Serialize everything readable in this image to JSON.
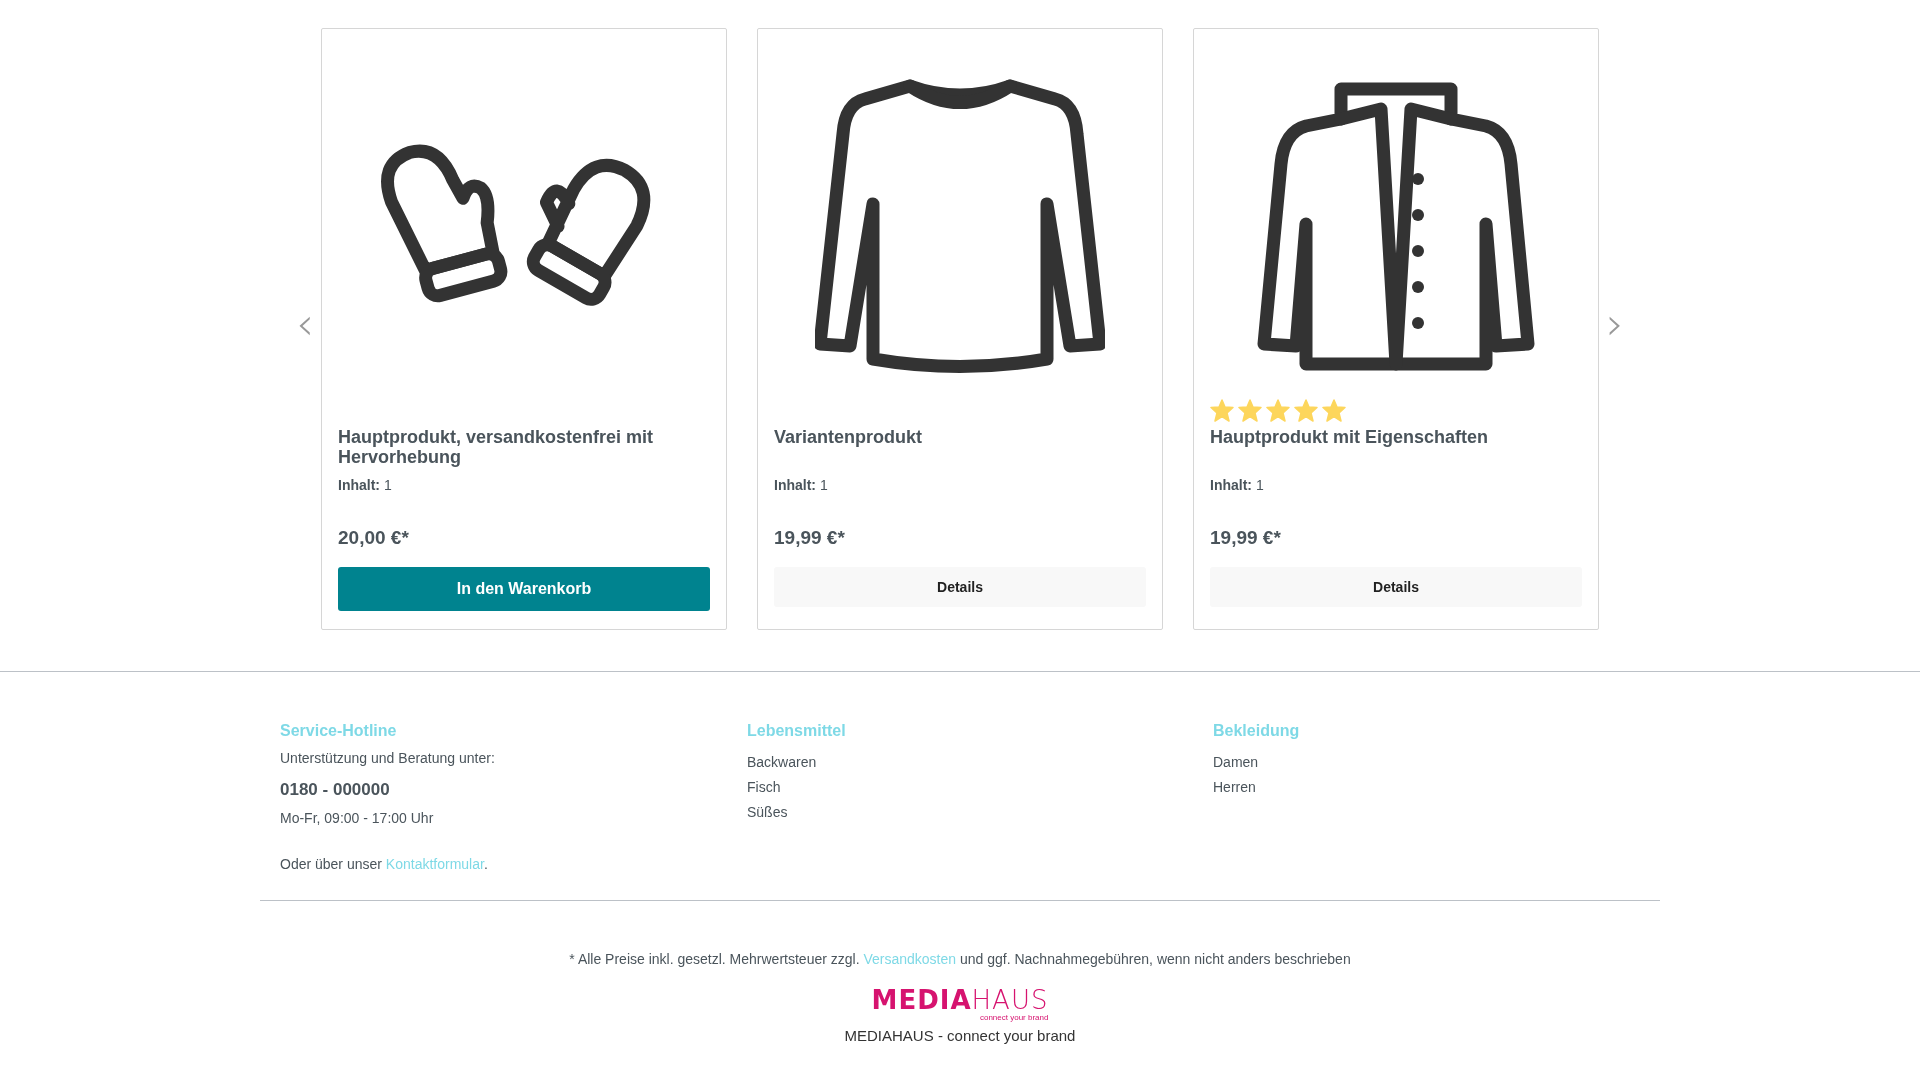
{
  "slider": {
    "prev": "‹",
    "next": "›"
  },
  "products": [
    {
      "title": "Hauptprodukt, versandkostenfrei mit Hervorhebung",
      "content_label": "Inhalt:",
      "content_value": "1",
      "price": "20,00 €*",
      "button": {
        "kind": "primary",
        "label": "In den Warenkorb"
      }
    },
    {
      "title": "Variantenprodukt",
      "content_label": "Inhalt:",
      "content_value": "1",
      "price": "19,99 €*",
      "button": {
        "kind": "secondary",
        "label": "Details"
      }
    },
    {
      "title": "Hauptprodukt mit Eigenschaften",
      "stars": 5,
      "content_label": "Inhalt:",
      "content_value": "1",
      "price": "19,99 €*",
      "button": {
        "kind": "secondary",
        "label": "Details"
      }
    }
  ],
  "footer": {
    "columns": [
      {
        "heading": "Service-Hotline",
        "lines": [
          {
            "kind": "text",
            "text": "Unterstützung und Beratung unter:"
          },
          {
            "kind": "phone",
            "text": "0180 - 000000"
          },
          {
            "kind": "text",
            "text": "Mo-Fr, 09:00 - 17:00 Uhr"
          },
          {
            "kind": "contact",
            "text": "Oder über unser",
            "link": "Kontaktformular",
            "after": "."
          }
        ]
      },
      {
        "heading": "Lebensmittel",
        "links": [
          "Backwaren",
          "Fisch",
          "Süßes"
        ]
      },
      {
        "heading": "Bekleidung",
        "links": [
          "Damen",
          "Herren"
        ]
      }
    ],
    "note": {
      "before": "* Alle Preise inkl. gesetzl. Mehrwertsteuer zzgl.",
      "link": "Versandkosten",
      "after": "und ggf. Nachnahmegebühren, wenn nicht anders beschrieben"
    },
    "logo": {
      "bold": "MEDIA",
      "light": "HAUS",
      "tagline": "connect your brand"
    },
    "caption": "MEDIAHAUS - connect your brand"
  }
}
